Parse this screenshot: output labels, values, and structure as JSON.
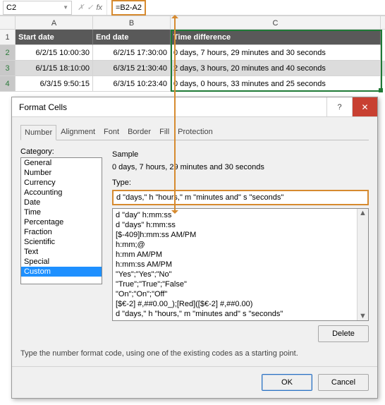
{
  "cell_ref": "C2",
  "formula": "=B2-A2",
  "columns": [
    "A",
    "B",
    "C"
  ],
  "header_row": {
    "a": "Start date",
    "b": "End date",
    "c": "Time difference"
  },
  "rows": [
    {
      "num": "2",
      "a": "6/2/15 10:00:30",
      "b": "6/2/15 17:30:00",
      "c": "0 days, 7 hours, 29 minutes and 30 seconds",
      "band": false
    },
    {
      "num": "3",
      "a": "6/1/15 18:10:00",
      "b": "6/3/15 21:30:40",
      "c": "2 days, 3 hours, 20 minutes and 40 seconds",
      "band": true
    },
    {
      "num": "4",
      "a": "6/3/15 9:50:15",
      "b": "6/3/15 10:23:40",
      "c": "0 days, 0 hours, 33 minutes and 25 seconds",
      "band": false
    }
  ],
  "dialog": {
    "title": "Format Cells",
    "tabs": [
      "Number",
      "Alignment",
      "Font",
      "Border",
      "Fill",
      "Protection"
    ],
    "active_tab": "Number",
    "category_label": "Category:",
    "categories": [
      "General",
      "Number",
      "Currency",
      "Accounting",
      "Date",
      "Time",
      "Percentage",
      "Fraction",
      "Scientific",
      "Text",
      "Special",
      "Custom"
    ],
    "selected_category": "Custom",
    "sample_label": "Sample",
    "sample_value": "0 days, 7 hours, 29 minutes and 30 seconds",
    "type_label": "Type:",
    "type_value": "d \"days,\" h \"hours,\" m \"minutes and\" s \"seconds\"",
    "type_options": [
      "d \"day\" h:mm:ss",
      "d \"days\" h:mm:ss",
      "[$-409]h:mm:ss AM/PM",
      "h:mm;@",
      " h:mm AM/PM",
      "h:mm:ss AM/PM",
      "\"Yes\";\"Yes\";\"No\"",
      "\"True\";\"True\";\"False\"",
      "\"On\";\"On\";\"Off\"",
      "[$€-2] #,##0.00_);[Red]([$€-2] #,##0.00)",
      "d \"days,\" h \"hours,\" m \"minutes and\" s \"seconds\""
    ],
    "delete_label": "Delete",
    "hint": "Type the number format code, using one of the existing codes as a starting point.",
    "ok_label": "OK",
    "cancel_label": "Cancel"
  }
}
